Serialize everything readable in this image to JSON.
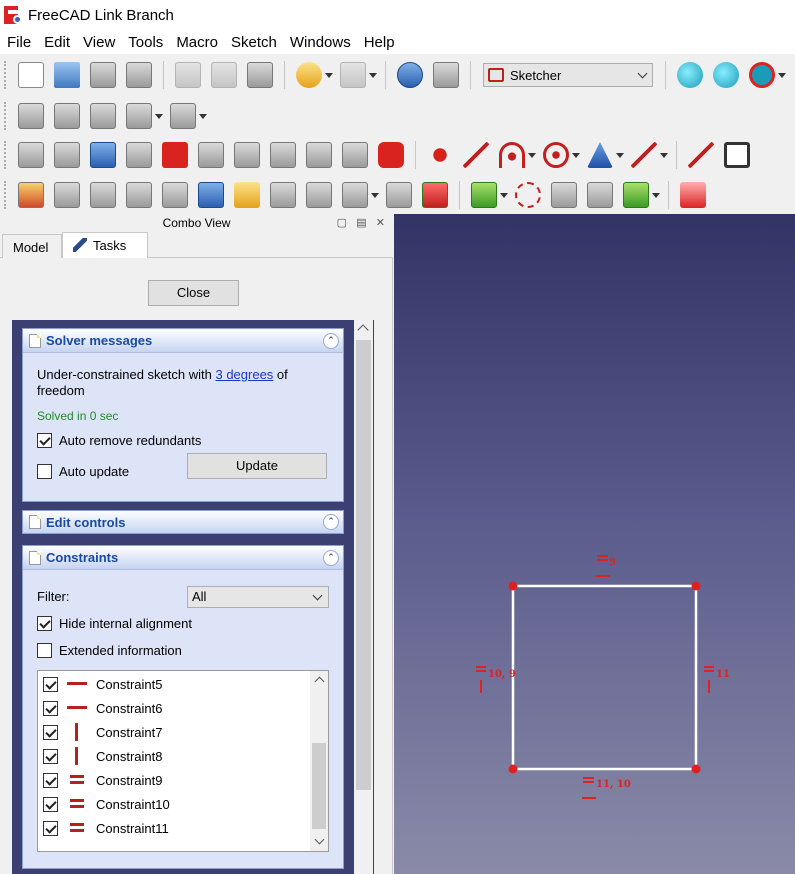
{
  "window": {
    "title": "FreeCAD Link Branch"
  },
  "menu": [
    "File",
    "Edit",
    "View",
    "Tools",
    "Macro",
    "Sketch",
    "Windows",
    "Help"
  ],
  "toolbar": {
    "workbench": "Sketcher"
  },
  "combo_view": {
    "title": "Combo View",
    "tabs": {
      "model": "Model",
      "tasks": "Tasks"
    },
    "close_label": "Close"
  },
  "solver_messages": {
    "title": "Solver messages",
    "message_before": "Under-constrained sketch with ",
    "message_link": "3 degrees",
    "message_after": " of freedom",
    "solved": "Solved in 0 sec",
    "auto_remove_label": "Auto remove redundants",
    "auto_remove_checked": true,
    "auto_update_label": "Auto update",
    "auto_update_checked": false,
    "update_label": "Update"
  },
  "edit_controls": {
    "title": "Edit controls"
  },
  "constraints": {
    "title": "Constraints",
    "filter_label": "Filter:",
    "filter_value": "All",
    "hide_internal_label": "Hide internal alignment",
    "hide_internal_checked": true,
    "extended_info_label": "Extended information",
    "extended_info_checked": false,
    "items": [
      {
        "name": "Constraint5",
        "type": "horizontal",
        "checked": true
      },
      {
        "name": "Constraint6",
        "type": "horizontal",
        "checked": true
      },
      {
        "name": "Constraint7",
        "type": "vertical",
        "checked": true
      },
      {
        "name": "Constraint8",
        "type": "vertical",
        "checked": true
      },
      {
        "name": "Constraint9",
        "type": "equal",
        "checked": true
      },
      {
        "name": "Constraint10",
        "type": "equal",
        "checked": true
      },
      {
        "name": "Constraint11",
        "type": "equal",
        "checked": true
      }
    ]
  },
  "sketch_view": {
    "labels": {
      "top": "9",
      "left": "10, 9",
      "right": "11",
      "bottom": "11, 10"
    },
    "colors": {
      "line": "#ffffff",
      "point": "#e02020",
      "constraint": "#d22222"
    }
  }
}
